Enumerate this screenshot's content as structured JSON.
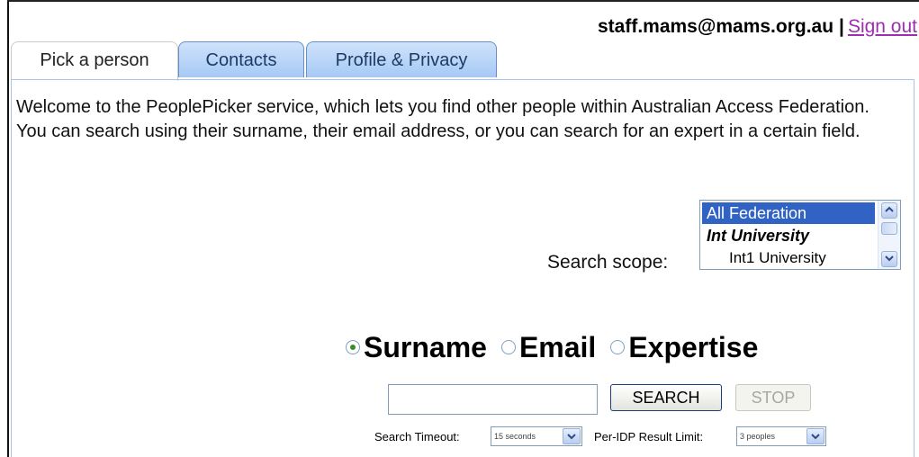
{
  "header": {
    "user_email": "staff.mams@mams.org.au",
    "separator": "|",
    "sign_out": "Sign out"
  },
  "tabs": [
    {
      "label": "Pick a person",
      "active": true
    },
    {
      "label": "Contacts",
      "active": false
    },
    {
      "label": "Profile & Privacy",
      "active": false
    }
  ],
  "intro": "Welcome to the PeoplePicker service, which lets you find other people within Australian Access Federation. You can search using their surname, their email address, or you can search for an expert in a certain field.",
  "scope": {
    "label": "Search scope:",
    "options": [
      "All Federation",
      "Int University",
      "Int1 University"
    ],
    "selected": "All Federation"
  },
  "search_type": {
    "options": [
      "Surname",
      "Email",
      "Expertise"
    ],
    "selected": "Surname"
  },
  "search": {
    "value": "",
    "search_button": "SEARCH",
    "stop_button": "STOP"
  },
  "options": {
    "timeout_label": "Search Timeout:",
    "timeout_value": "15 seconds",
    "limit_label": "Per-IDP Result Limit:",
    "limit_value": "3 peoples"
  },
  "colors": {
    "selected_highlight": "#3163c5",
    "tab_inactive": "#a6c9f4",
    "link": "#9b2fae",
    "radio_checked": "#3b8b2d"
  }
}
